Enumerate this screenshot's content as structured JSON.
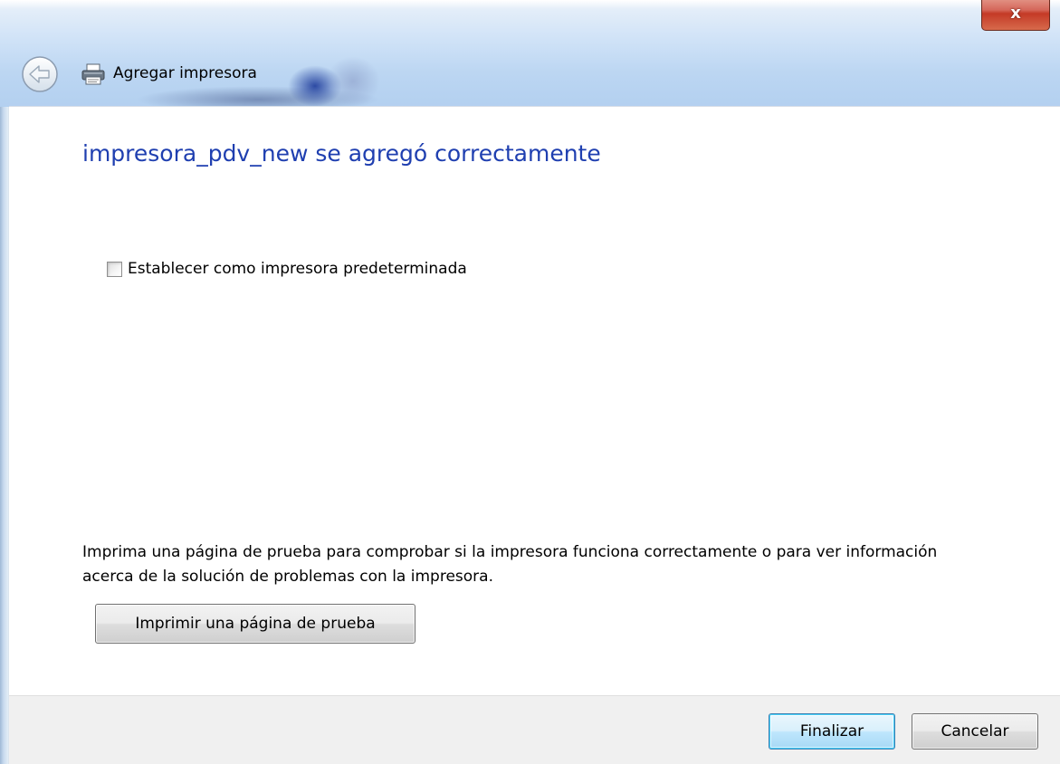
{
  "window": {
    "title": "Agregar impresora",
    "close_label": "x"
  },
  "main": {
    "heading": "impresora_pdv_new se agregó correctamente",
    "default_printer_checkbox": {
      "label": "Establecer como impresora predeterminada",
      "checked": false
    },
    "info_text": "Imprima una página de prueba para comprobar si la impresora funciona correctamente o para ver información acerca de la solución de problemas con la impresora.",
    "test_page_button": "Imprimir una página de prueba"
  },
  "footer": {
    "finish_label": "Finalizar",
    "cancel_label": "Cancelar"
  },
  "colors": {
    "heading": "#1f3fb0",
    "footer_bg": "#f0f0f0",
    "titlebar": "#bcd6f2",
    "close_button": "#c43a26",
    "default_button_border": "#3c7fb1"
  },
  "icons": {
    "back": "back-arrow-icon",
    "printer": "printer-icon",
    "close": "close-icon"
  }
}
